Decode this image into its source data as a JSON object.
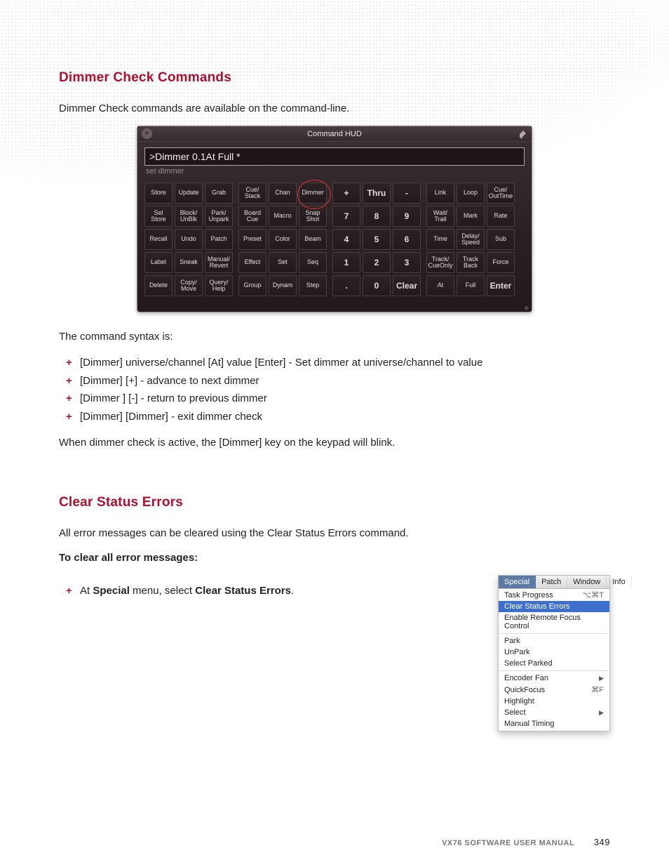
{
  "heading1": "Dimmer Check Commands",
  "intro1": "Dimmer Check commands are available on the command-line.",
  "hud": {
    "title": "Command HUD",
    "cmdline": ">Dimmer 0.1At Full *",
    "hint": "set dimmer",
    "groupA": [
      "Store",
      "Update",
      "Grab",
      "Sel\nStore",
      "Block/\nUnBlk",
      "Park/\nUnpark",
      "Recall",
      "Undo",
      "Patch",
      "Label",
      "Sneak",
      "Manual/\nRevert",
      "Delete",
      "Copy/\nMove",
      "Query/\nHelp"
    ],
    "groupB": [
      "Cue/\nStack",
      "Chan",
      "Dimmer",
      "Board\nCue",
      "Macro",
      "Snap\nShot",
      "Preset",
      "Color",
      "Beam",
      "Effect",
      "Set",
      "Seq",
      "Group",
      "Dynam",
      "Step"
    ],
    "groupC": [
      "+",
      "Thru",
      "-",
      "7",
      "8",
      "9",
      "4",
      "5",
      "6",
      "1",
      "2",
      "3",
      ".",
      "0",
      "Clear"
    ],
    "groupD": [
      "Link",
      "Loop",
      "Cue/\nOutTime",
      "Wait/\nTrail",
      "Mark",
      "Rate",
      "Time",
      "Delay/\nSpeed",
      "Sub",
      "Track/\nCueOnly",
      "Track\nBack",
      "Force",
      "At",
      "Full",
      "Enter"
    ]
  },
  "syntax_lead": "The command syntax is:",
  "syntax_items": [
    "[Dimmer] universe/channel [At] value [Enter] - Set dimmer at universe/channel to value",
    "[Dimmer] [+] - advance to next dimmer",
    "[Dimmer ] [-] - return to previous dimmer",
    "[Dimmer] [Dimmer] - exit dimmer check"
  ],
  "syntax_trail": "When dimmer check is active, the [Dimmer] key on the keypad will blink.",
  "heading2": "Clear Status Errors",
  "intro2": "All error messages can be cleared using the Clear Status Errors command.",
  "steps_lead": "To clear all error messages:",
  "step_prefix": "At ",
  "step_bold1": "Special",
  "step_mid": " menu, select ",
  "step_bold2": "Clear Status Errors",
  "step_suffix": ".",
  "menu": {
    "tabs": [
      "Special",
      "Patch",
      "Window",
      "Info"
    ],
    "active_tab": 0,
    "items": [
      {
        "label": "Task Progress",
        "sc": "⌥⌘T"
      },
      {
        "label": "Clear Status Errors",
        "selected": true
      },
      {
        "label": "Enable Remote Focus Control"
      },
      {
        "sep": true
      },
      {
        "label": "Park"
      },
      {
        "label": "UnPark"
      },
      {
        "label": "Select Parked"
      },
      {
        "sep": true
      },
      {
        "label": "Encoder Fan",
        "arrow": true
      },
      {
        "label": "QuickFocus",
        "sc": "⌘F"
      },
      {
        "label": "Highlight"
      },
      {
        "label": "Select",
        "arrow": true
      },
      {
        "label": "Manual Timing"
      }
    ]
  },
  "footer_title": "VX76 SOFTWARE USER MANUAL",
  "footer_page": "349"
}
